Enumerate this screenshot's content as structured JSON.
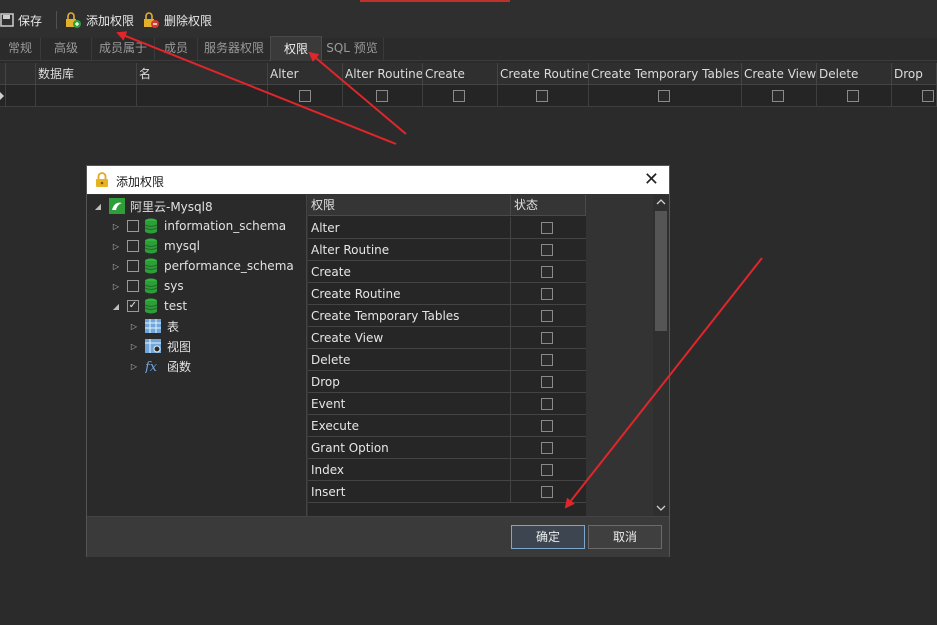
{
  "toolbar": {
    "save_label": "保存",
    "add_privilege_label": "添加权限",
    "delete_privilege_label": "删除权限"
  },
  "tabs": [
    {
      "label": "常规"
    },
    {
      "label": "高级"
    },
    {
      "label": "成员属于"
    },
    {
      "label": "成员"
    },
    {
      "label": "服务器权限"
    },
    {
      "label": "权限"
    },
    {
      "label": "SQL 预览"
    }
  ],
  "grid": {
    "columns": [
      "数据库",
      "名",
      "Alter",
      "Alter Routine",
      "Create",
      "Create Routine",
      "Create Temporary Tables",
      "Create View",
      "Delete",
      "Drop"
    ]
  },
  "dialog": {
    "title": "添加权限",
    "tree": {
      "connection": "阿里云-Mysql8",
      "databases": [
        {
          "name": "information_schema",
          "checked": false
        },
        {
          "name": "mysql",
          "checked": false
        },
        {
          "name": "performance_schema",
          "checked": false
        },
        {
          "name": "sys",
          "checked": false
        },
        {
          "name": "test",
          "checked": true
        }
      ],
      "children": [
        {
          "label": "表",
          "icon": "table-icon"
        },
        {
          "label": "视图",
          "icon": "view-icon"
        },
        {
          "label": "函数",
          "icon": "function-icon"
        }
      ]
    },
    "privileges_table": {
      "header_privilege": "权限",
      "header_status": "状态",
      "rows": [
        "Alter",
        "Alter Routine",
        "Create",
        "Create Routine",
        "Create Temporary Tables",
        "Create View",
        "Delete",
        "Drop",
        "Event",
        "Execute",
        "Grant Option",
        "Index",
        "Insert"
      ]
    },
    "ok_label": "确定",
    "cancel_label": "取消"
  },
  "colors": {
    "background": "#2b2b2b",
    "db_icon": "#2e9e3a",
    "annotation_arrow": "#e0262a",
    "primary_button_border": "#7aa6cf"
  }
}
